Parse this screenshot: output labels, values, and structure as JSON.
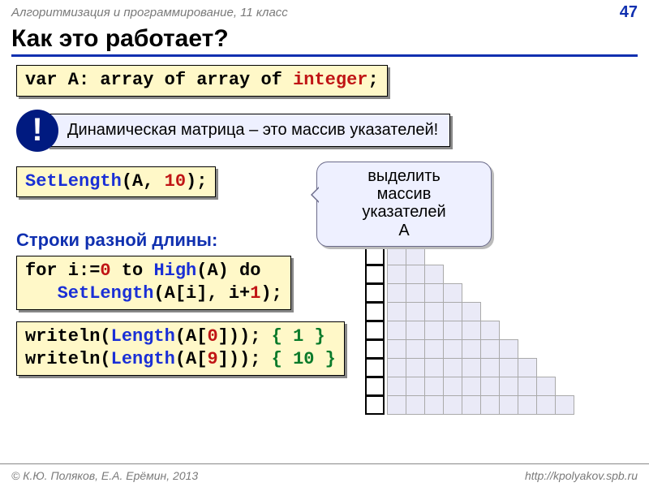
{
  "header": {
    "course": "Алгоритмизация и программирование, 11 класс",
    "page": "47"
  },
  "title": "Как это работает?",
  "code1": {
    "p1": "var A: array of array of ",
    "p2": "integer",
    "p3": ";"
  },
  "callout": {
    "mark": "!",
    "text": "Динамическая матрица – это  массив указателей!"
  },
  "code2": {
    "fn": "SetLength",
    "lp": "(A, ",
    "num": "10",
    "rp": ");"
  },
  "bubble": {
    "l1": "выделить",
    "l2": "массив",
    "l3": "указателей",
    "l4": "A"
  },
  "subhead": "Строки разной длины:",
  "code3": {
    "l1a": "for i:=",
    "l1b": "0",
    "l1c": " to ",
    "l1d": "High",
    "l1e": "(A) do",
    "l2a": "   ",
    "l2b": "SetLength",
    "l2c": "(A[i], i+",
    "l2d": "1",
    "l2e": ");"
  },
  "code4": {
    "l1a": "writeln(",
    "l1b": "Length",
    "l1c": "(A[",
    "l1d": "0",
    "l1e": "])); ",
    "l1f": "{ 1 }",
    "l2a": "writeln(",
    "l2b": "Length",
    "l2c": "(A[",
    "l2d": "9",
    "l2e": "])); ",
    "l2f": "{ 10 }"
  },
  "footer": {
    "left": "© К.Ю. Поляков, Е.А. Ерёмин, 2013",
    "right": "http://kpolyakov.spb.ru"
  }
}
